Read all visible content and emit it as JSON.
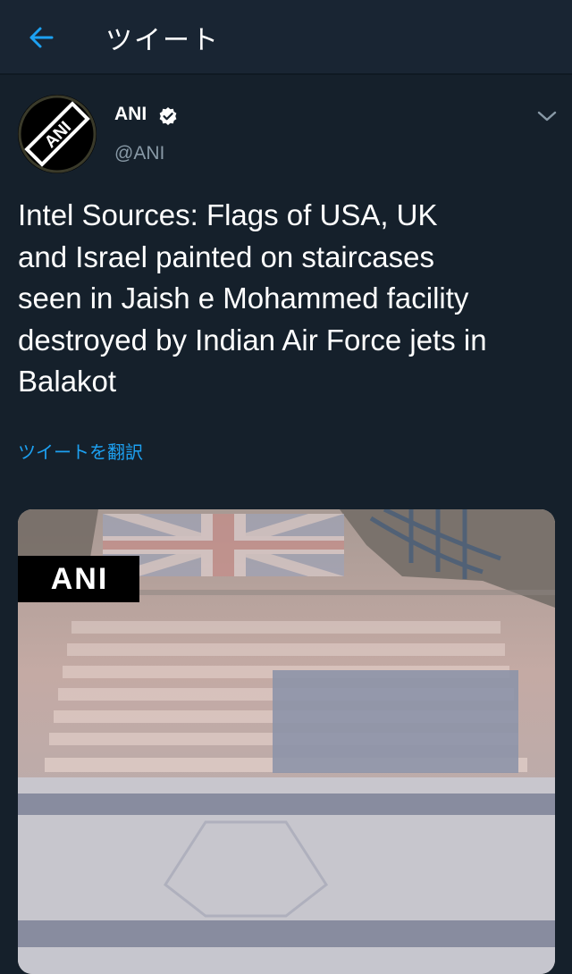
{
  "header": {
    "title": "ツイート",
    "back_icon": "arrow-left-icon"
  },
  "tweet": {
    "author": {
      "name": "ANI",
      "handle": "@ANI",
      "verified": true,
      "avatar_logo_text": "ANI"
    },
    "text": "Intel Sources: Flags of USA, UK\nand Israel painted on staircases\nseen in Jaish e Mohammed facility\ndestroyed by Indian Air Force jets in\nBalakot",
    "translate_label": "ツイートを翻訳",
    "media": {
      "watermark": "ANI"
    }
  },
  "colors": {
    "background": "#15202b",
    "header_background": "#192533",
    "accent": "#1da1f2",
    "secondary_text": "#8899a6"
  }
}
